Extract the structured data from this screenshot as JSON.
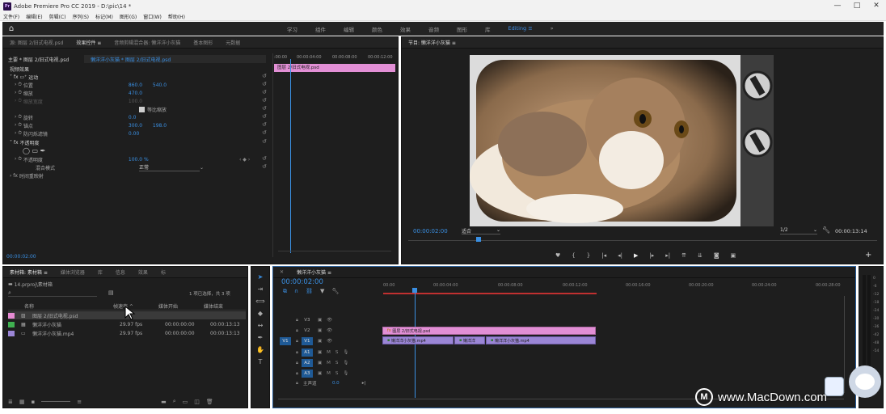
{
  "window": {
    "title": "Adobe Premiere Pro CC 2019 - D:\\pic\\14 *",
    "logo": "Pr",
    "controls": [
      "—",
      "□",
      "✕"
    ]
  },
  "menu": [
    "文件(F)",
    "编辑(E)",
    "剪辑(C)",
    "序列(S)",
    "标记(M)",
    "图形(G)",
    "窗口(W)",
    "帮助(H)"
  ],
  "workspaces": {
    "home_icon": "home-icon",
    "items": [
      "学习",
      "组件",
      "编辑",
      "颜色",
      "效果",
      "音频",
      "图形",
      "库"
    ],
    "active": "Editing ≡",
    "more": "»"
  },
  "left_panel": {
    "tabs": [
      "源: 图层 2/旧式电视.psd",
      "效果控件 ≡",
      "音频剪辑混合器: 懒洋洋小灰猫",
      "基本图形",
      "元数据"
    ],
    "clip_header": "主要 * 图层 2/旧式电视.psd",
    "clip_selector": "懒洋洋小灰猫 * 图层 2/旧式电视.psd",
    "mini_ruler": [
      ":00:00",
      "00:00:04:00",
      "00:00:08:00",
      "00:00:12:00"
    ],
    "clip_name": "图层 2/旧式电视.psd",
    "section_video": "视频效果",
    "motion": "运动",
    "props": [
      {
        "name": "位置",
        "v1": "860.0",
        "v2": "540.0"
      },
      {
        "name": "缩放",
        "v1": "470.0",
        "v2": ""
      },
      {
        "name": "缩放宽度",
        "v1": "100.0",
        "v2": ""
      },
      {
        "name": "旋转",
        "v1": "0.0",
        "v2": ""
      },
      {
        "name": "锚点",
        "v1": "300.0",
        "v2": "198.0"
      },
      {
        "name": "防闪烁滤镜",
        "v1": "0.00",
        "v2": ""
      }
    ],
    "uniform_scale": "等比缩放",
    "opacity_section": "不透明度",
    "opacity": {
      "name": "不透明度",
      "value": "100.0 %"
    },
    "blend": {
      "name": "混合模式",
      "value": "正常"
    },
    "time_remap": "时间重映射",
    "timecode": "00:00:02:00"
  },
  "program": {
    "tab": "节目: 懒洋洋小灰猫 ≡",
    "timecode": "00:00:02:00",
    "fit": "适合",
    "ratio": "1/2",
    "duration": "00:00:13:14"
  },
  "project": {
    "tabs": [
      "素材箱: 素材箱 ≡",
      "媒体浏览器",
      "库",
      "信息",
      "效果",
      "标"
    ],
    "path": "14.prproj\\素材箱",
    "selection": "1 项已选择，共 3 项",
    "columns": [
      "名称",
      "帧速率 ^",
      "媒体开始",
      "媒体结束"
    ],
    "items": [
      {
        "name": "图层 2/旧式电视.psd",
        "fps": "",
        "start": "",
        "end": "",
        "color": "#e58ad2"
      },
      {
        "name": "懒洋洋小灰猫",
        "fps": "29.97 fps",
        "start": "00:00:00:00",
        "end": "00:00:13:13",
        "color": "#3fb050"
      },
      {
        "name": "懒洋洋小灰猫.mp4",
        "fps": "29.97 fps",
        "start": "00:00:00:00",
        "end": "00:00:13:13",
        "color": "#9b86d6"
      }
    ]
  },
  "timeline": {
    "tab": "懒洋洋小灰猫 ≡",
    "timecode": "00:00:02:00",
    "ruler": [
      "00:00",
      "00:00:04:00",
      "00:00:08:00",
      "00:00:12:00",
      "00:00:16:00",
      "00:00:20:00",
      "00:00:24:00",
      "00:00:28:00"
    ],
    "tracks": [
      "V3",
      "V2",
      "V1",
      "A1",
      "A2",
      "A3"
    ],
    "v1_source": "V1",
    "a1_source": "A1",
    "master": {
      "label": "主声道",
      "value": "0.0"
    },
    "clips": {
      "v2": "图层 2/旧式电视.psd",
      "v1": [
        "懒洋洋小灰猫.mp4",
        "懒洋洋",
        "懒洋洋小灰猫.mp4"
      ]
    },
    "meter_scale": [
      "0",
      "-6",
      "-12",
      "-18",
      "-24",
      "-30",
      "-36",
      "-42",
      "-48",
      "-54"
    ]
  },
  "watermark": "www.MacDown.com"
}
